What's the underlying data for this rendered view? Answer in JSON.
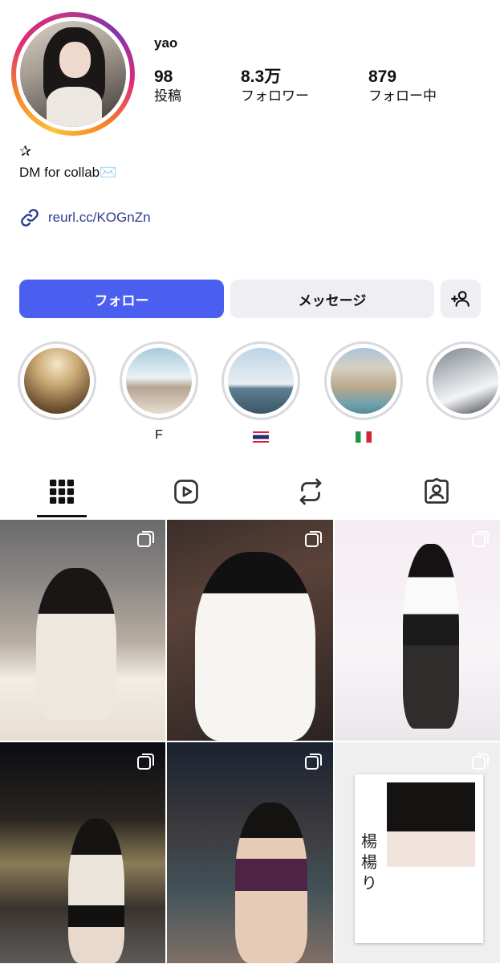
{
  "profile": {
    "username": "yao",
    "stats": {
      "posts": {
        "value": "98",
        "label": "投稿"
      },
      "followers": {
        "value": "8.3万",
        "label": "フォロワー"
      },
      "following": {
        "value": "879",
        "label": "フォロー中"
      }
    },
    "bio_star": "✰",
    "bio_text": "DM for collab✉️",
    "link": "reurl.cc/KOGnZn"
  },
  "actions": {
    "follow_label": "フォロー",
    "message_label": "メッセージ",
    "add_user_icon": "person-add-icon"
  },
  "highlights": [
    {
      "label": ""
    },
    {
      "label": "F"
    },
    {
      "label": "",
      "flag": "thailand-flag"
    },
    {
      "label": "",
      "flag": "italy-flag"
    },
    {
      "label": ""
    }
  ],
  "tabs": [
    {
      "icon": "grid-icon",
      "active": true
    },
    {
      "icon": "reels-icon",
      "active": false
    },
    {
      "icon": "repost-icon",
      "active": false
    },
    {
      "icon": "tagged-icon",
      "active": false
    }
  ],
  "posts": [
    {
      "multiple": true
    },
    {
      "multiple": true
    },
    {
      "multiple": true
    },
    {
      "multiple": true
    },
    {
      "multiple": true
    },
    {
      "multiple": true,
      "caption_text": "楊楊り"
    }
  ],
  "colors": {
    "follow_button": "#4a5ef0",
    "secondary_button": "#efeff3",
    "link": "#2b3c8f"
  }
}
